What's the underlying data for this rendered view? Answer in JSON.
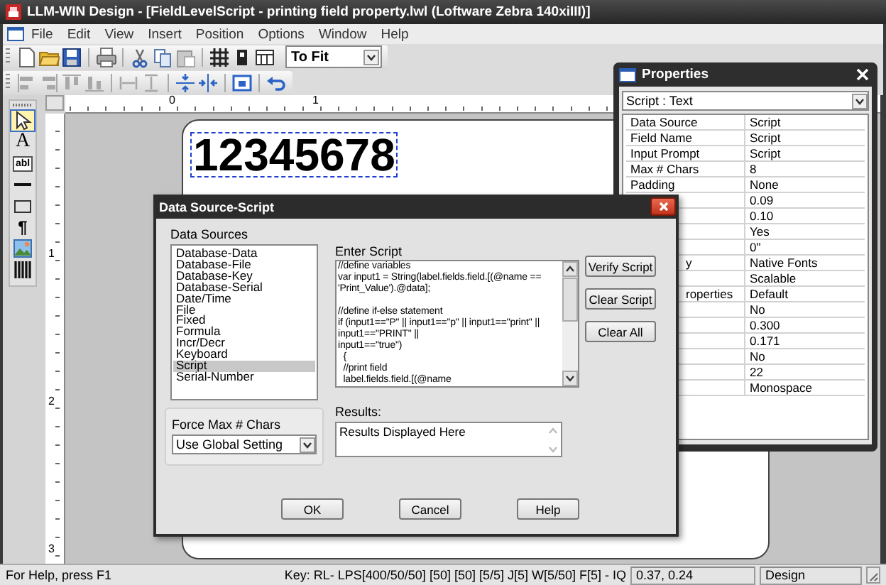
{
  "window": {
    "title": "LLM-WIN Design - [FieldLevelScript - printing field property.lwl (Loftware Zebra 140xiIII)]"
  },
  "menu": [
    "File",
    "Edit",
    "View",
    "Insert",
    "Position",
    "Options",
    "Window",
    "Help"
  ],
  "toolbar": {
    "zoom": "To Fit"
  },
  "tools": [
    {
      "kind": "pointer",
      "selected": true
    },
    {
      "kind": "text",
      "glyph": "A",
      "selected": false
    },
    {
      "kind": "textbox",
      "glyph": "abl",
      "selected": false
    },
    {
      "kind": "line",
      "selected": false
    },
    {
      "kind": "rectangle",
      "selected": false
    },
    {
      "kind": "paragraph",
      "glyph": "¶",
      "selected": false
    },
    {
      "kind": "picture",
      "selected": false
    },
    {
      "kind": "barcode",
      "selected": false
    }
  ],
  "rulers": {
    "horizontal": [
      "0",
      "1"
    ],
    "vertical": [
      "1",
      "2",
      "3"
    ]
  },
  "canvas": {
    "field_text": "12345678",
    "field_selected": true
  },
  "properties": {
    "title": "Properties",
    "object": "Script : Text",
    "rows": [
      {
        "name": "Data Source",
        "value": "Script"
      },
      {
        "name": "Field Name",
        "value": "Script"
      },
      {
        "name": "Input Prompt",
        "value": "Script"
      },
      {
        "name": "Max # Chars",
        "value": "8"
      },
      {
        "name": "Padding",
        "value": "None"
      },
      {
        "value": "0.09"
      },
      {
        "value": "0.10"
      },
      {
        "value": "Yes"
      },
      {
        "value": "0\""
      },
      {
        "name": "y",
        "cut": true,
        "value": "Native Fonts"
      },
      {
        "value": "Scalable"
      },
      {
        "name": "roperties",
        "cut": true,
        "value": "Default"
      },
      {
        "value": "No"
      },
      {
        "value": "0.300"
      },
      {
        "value": "0.171"
      },
      {
        "value": "No"
      },
      {
        "value": "22"
      },
      {
        "value": "Monospace"
      }
    ]
  },
  "dialog": {
    "title": "Data Source-Script",
    "sources_label": "Data Sources",
    "sources": [
      {
        "label": "Database-Data",
        "selected": false
      },
      {
        "label": "Database-File",
        "selected": false
      },
      {
        "label": "Database-Key",
        "selected": false
      },
      {
        "label": "Database-Serial",
        "selected": false
      },
      {
        "label": "Date/Time",
        "selected": false
      },
      {
        "label": "File",
        "selected": false
      },
      {
        "label": "Fixed",
        "selected": false
      },
      {
        "label": "Formula",
        "selected": false
      },
      {
        "label": "Incr/Decr",
        "selected": false
      },
      {
        "label": "Keyboard",
        "selected": false
      },
      {
        "label": "Script",
        "selected": true
      },
      {
        "label": "Serial-Number",
        "selected": false
      }
    ],
    "force_label": "Force Max # Chars",
    "force_value": "Use Global Setting",
    "script_label": "Enter Script",
    "script": "//define variables\nvar input1 = String(label.fields.field.[(@name ==\n'Print_Value').@data];\n\n//define if-else statement\nif (input1==\"P\" || input1==\"p\" || input1==\"print\" ||\ninput1==\"PRINT\" ||\ninput1==\"true\")\n  {\n  //print field\n  label.fields.field.[(@name",
    "side_buttons": [
      "Verify Script",
      "Clear Script",
      "Clear All"
    ],
    "results_label": "Results:",
    "results": "Results Displayed Here",
    "buttons": [
      "OK",
      "Cancel",
      "Help"
    ]
  },
  "status_bar": {
    "help": "For Help, press F1",
    "key": "Key: RL- LPS[400/50/50] [50] [50] [5/5] J[5] W[5/50] F[5] - IQ",
    "position": "0.37, 0.24",
    "mode": "Design"
  }
}
